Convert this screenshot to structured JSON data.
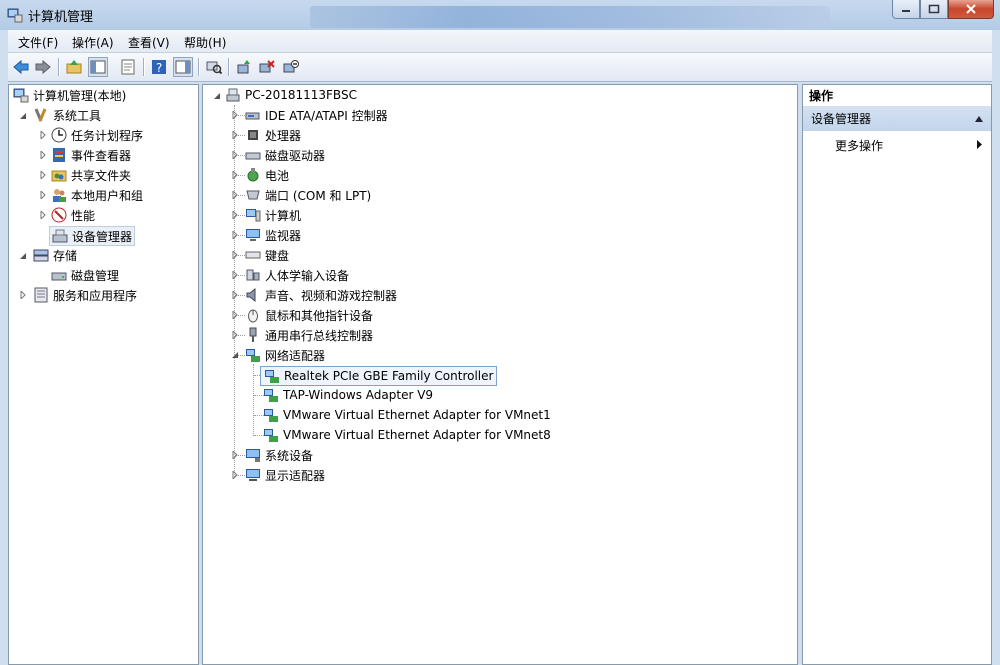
{
  "window": {
    "title": "计算机管理"
  },
  "menu": [
    "文件(F)",
    "操作(A)",
    "查看(V)",
    "帮助(H)"
  ],
  "left_tree": {
    "root": "计算机管理(本地)",
    "system_tools": "系统工具",
    "task_scheduler": "任务计划程序",
    "event_viewer": "事件查看器",
    "shared_folders": "共享文件夹",
    "local_users": "本地用户和组",
    "performance": "性能",
    "device_manager": "设备管理器",
    "storage": "存储",
    "disk_management": "磁盘管理",
    "services_apps": "服务和应用程序"
  },
  "devices": {
    "computer": "PC-20181113FBSC",
    "categories": [
      "IDE ATA/ATAPI 控制器",
      "处理器",
      "磁盘驱动器",
      "电池",
      "端口 (COM 和 LPT)",
      "计算机",
      "监视器",
      "键盘",
      "人体学输入设备",
      "声音、视频和游戏控制器",
      "鼠标和其他指针设备",
      "通用串行总线控制器",
      "网络适配器"
    ],
    "network_adapters": [
      "Realtek PCIe GBE Family Controller",
      "TAP-Windows Adapter V9",
      "VMware Virtual Ethernet Adapter for VMnet1",
      "VMware Virtual Ethernet Adapter for VMnet8"
    ],
    "after": [
      "系统设备",
      "显示适配器"
    ]
  },
  "actions": {
    "header": "操作",
    "section": "设备管理器",
    "more": "更多操作"
  }
}
